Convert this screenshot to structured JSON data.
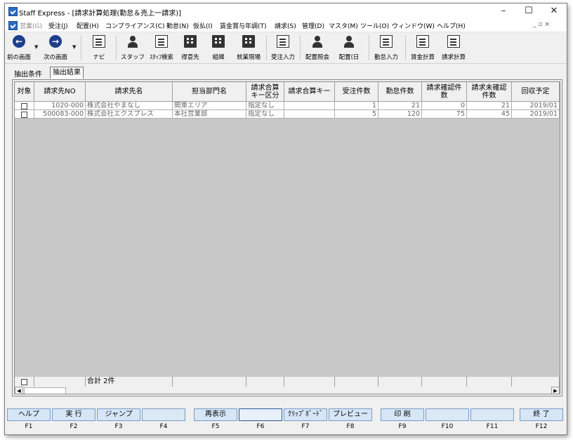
{
  "window": {
    "title": "Staff Express - [請求計算処理(勤怠＆売上一請求)]",
    "minimize_glyph": "–",
    "maximize_glyph": "☐",
    "close_glyph": "✕"
  },
  "menu": {
    "items": [
      {
        "label": "営業(G)",
        "disabled": true
      },
      {
        "label": "受注(J)"
      },
      {
        "label": "配置(H)"
      },
      {
        "label": "コンプライアンス(C)"
      },
      {
        "label": "勤怠(N)"
      },
      {
        "label": "仮払(I)"
      },
      {
        "label": "賃金賞与年調(T)"
      },
      {
        "label": "請求(S)"
      },
      {
        "label": "管理(D)"
      },
      {
        "label": "マスタ(M)"
      },
      {
        "label": "ツール(O)"
      },
      {
        "label": "ウィンドウ(W)"
      },
      {
        "label": "ヘルプ(H)"
      }
    ],
    "mdi_controls": "_ ▫ ×"
  },
  "toolbar": {
    "back": "前の画面",
    "forward": "次の画面",
    "navi": "ナビ",
    "staff": "スタッフ",
    "staff_search": "ｽﾀｯﾌ検索",
    "client": "得意先",
    "org": "組織",
    "worksite": "就業現場",
    "order_entry": "受注入力",
    "assign_inquiry": "配置照会",
    "assign_day": "配置(日",
    "attendance_entry": "勤怠入力",
    "wage_calc": "賃金計算",
    "billing_calc": "請求計算"
  },
  "tabs": {
    "conditions": "抽出条件",
    "results": "抽出結果"
  },
  "table": {
    "headers": [
      "対象",
      "請求先NO",
      "請求先名",
      "担当部門名",
      "請求合算\nキー区分",
      "請求合算キー",
      "受注件数",
      "勤怠件数",
      "請求確認件\n数",
      "請求未確認\n件数",
      "回収予定"
    ],
    "rows": [
      [
        "",
        "1020-000",
        "株式会社やまなし",
        "関東エリア",
        "指定なし",
        "",
        "1",
        "21",
        "0",
        "21",
        "2019/01"
      ],
      [
        "",
        "500083-000",
        "株式会社エクスプレス",
        "本社営業部",
        "指定なし",
        "",
        "5",
        "120",
        "75",
        "45",
        "2019/01"
      ]
    ],
    "footer_total": "合計 2件"
  },
  "fkeys": [
    {
      "label": "ヘルプ",
      "num": "F1"
    },
    {
      "label": "実 行",
      "num": "F2"
    },
    {
      "label": "ジャンプ",
      "num": "F3"
    },
    {
      "label": "",
      "num": "F4"
    },
    {
      "label": "再表示",
      "num": "F5"
    },
    {
      "label": "",
      "num": "F6"
    },
    {
      "label": "ｸﾘｯﾌﾟﾎﾞｰﾄﾞ",
      "num": "F7"
    },
    {
      "label": "プレビュー",
      "num": "F8"
    },
    {
      "label": "印 刷",
      "num": "F9"
    },
    {
      "label": "",
      "num": "F10"
    },
    {
      "label": "",
      "num": "F11"
    },
    {
      "label": "終 了",
      "num": "F12"
    }
  ]
}
